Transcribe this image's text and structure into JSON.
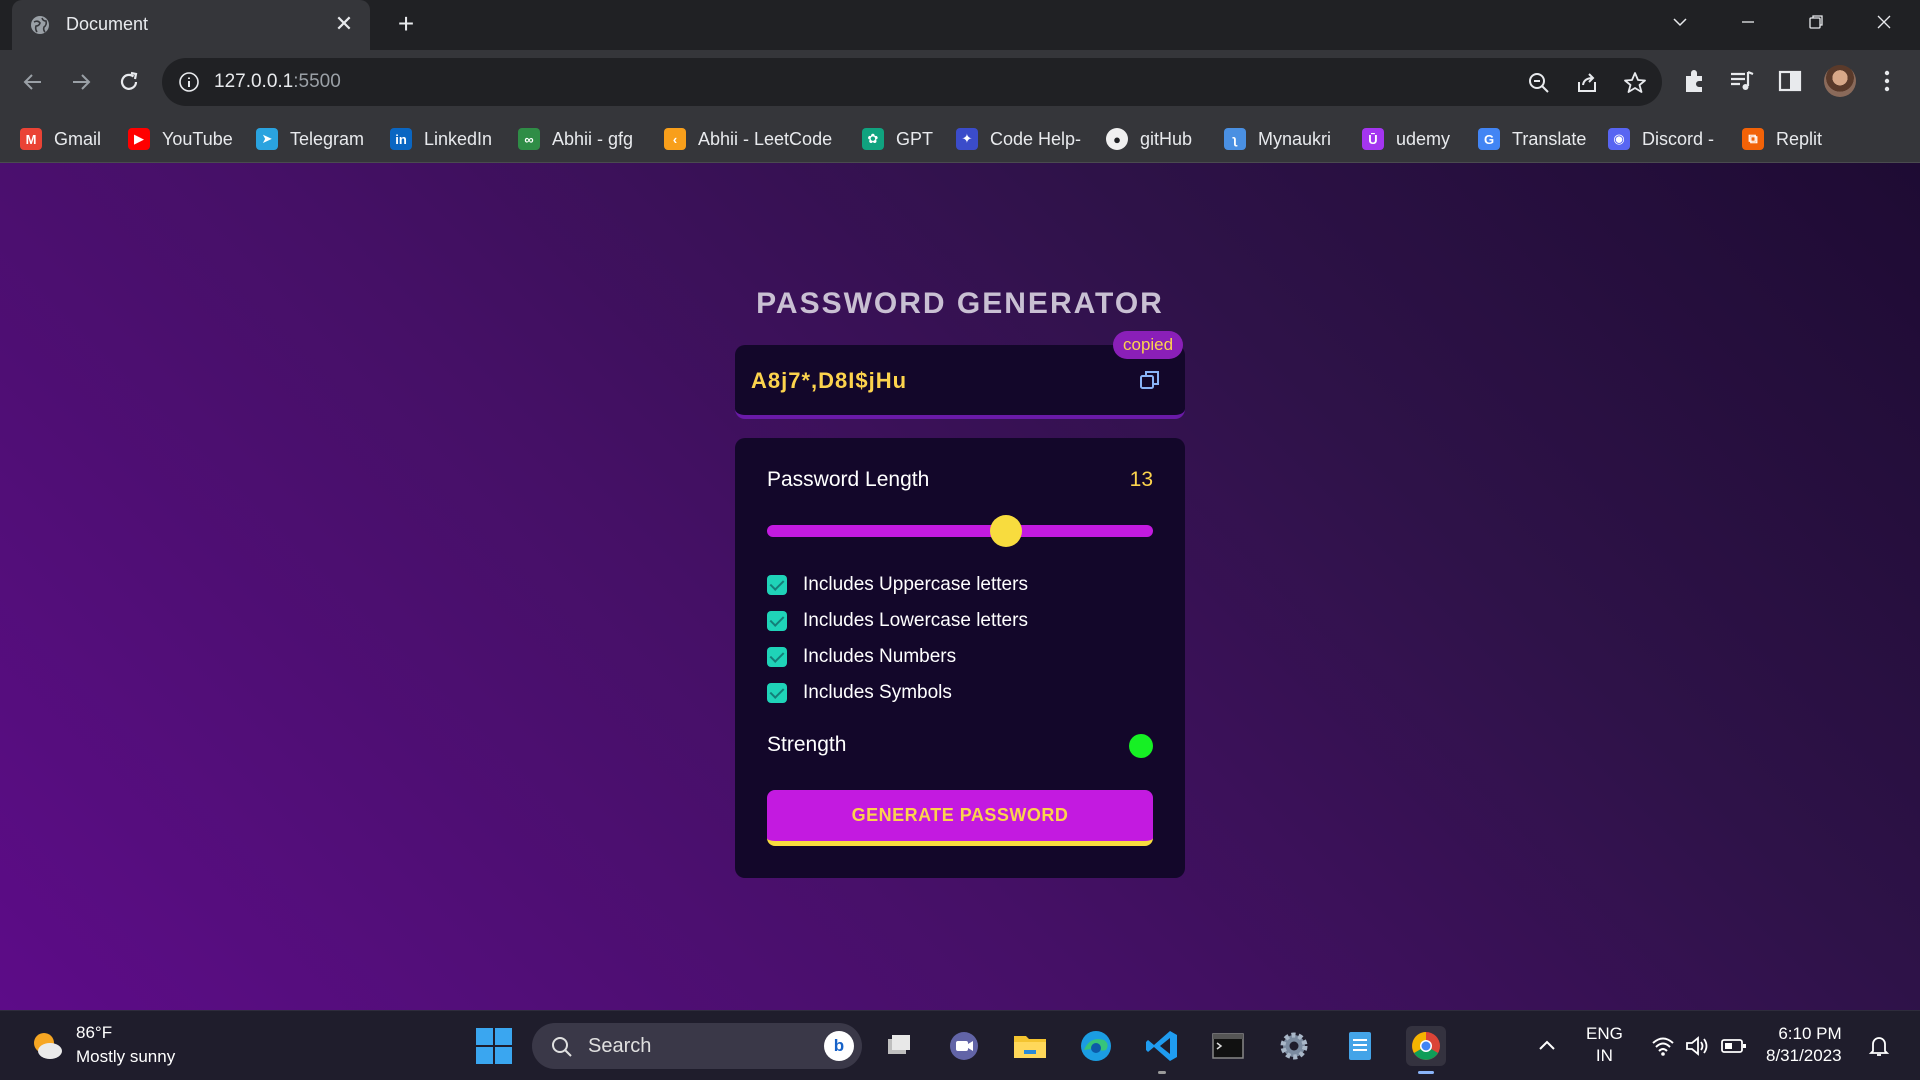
{
  "browser": {
    "tab_title": "Document",
    "url_host": "127.0.0.1",
    "url_port": ":5500",
    "bookmarks": [
      {
        "label": "Gmail",
        "icon": "gmail-icon",
        "color": "#ea4335",
        "glyph": "M"
      },
      {
        "label": "YouTube",
        "icon": "youtube-icon",
        "color": "#ff0000",
        "glyph": "▶"
      },
      {
        "label": "Telegram",
        "icon": "telegram-icon",
        "color": "#2aa3df",
        "glyph": "➤"
      },
      {
        "label": "LinkedIn",
        "icon": "linkedin-icon",
        "color": "#0a66c2",
        "glyph": "in"
      },
      {
        "label": "Abhii - gfg",
        "icon": "gfg-icon",
        "color": "#2f8d46",
        "glyph": "∞"
      },
      {
        "label": "Abhii - LeetCode",
        "icon": "leetcode-icon",
        "color": "#f89f1b",
        "glyph": "‹"
      },
      {
        "label": "GPT",
        "icon": "chatgpt-icon",
        "color": "#10a37f",
        "glyph": "✿"
      },
      {
        "label": "Code Help-",
        "icon": "codehelp-icon",
        "color": "#3b4cca",
        "glyph": "✦"
      },
      {
        "label": "gitHub",
        "icon": "github-icon",
        "color": "#f0f0f0",
        "glyph": "●"
      },
      {
        "label": "Mynaukri",
        "icon": "naukri-icon",
        "color": "#4a90e2",
        "glyph": "ʅ"
      },
      {
        "label": "udemy",
        "icon": "udemy-icon",
        "color": "#a435f0",
        "glyph": "Ū"
      },
      {
        "label": "Translate",
        "icon": "translate-icon",
        "color": "#4285f4",
        "glyph": "G"
      },
      {
        "label": "Discord -",
        "icon": "discord-icon",
        "color": "#5865f2",
        "glyph": "◉"
      },
      {
        "label": "Replit",
        "icon": "replit-icon",
        "color": "#f26207",
        "glyph": "⧉"
      }
    ]
  },
  "app": {
    "title": "PASSWORD GENERATOR",
    "password": "A8j7*,D8I$jHu",
    "copied_badge": "copied",
    "length_label": "Password Length",
    "length_value": "13",
    "slider_fraction": 0.62,
    "options": [
      {
        "label": "Includes Uppercase letters",
        "checked": true
      },
      {
        "label": "Includes Lowercase letters",
        "checked": true
      },
      {
        "label": "Includes Numbers",
        "checked": true
      },
      {
        "label": "Includes Symbols",
        "checked": true
      }
    ],
    "strength_label": "Strength",
    "strength_color": "#16f024",
    "generate_label": "GENERATE PASSWORD"
  },
  "taskbar": {
    "temperature": "86°F",
    "weather": "Mostly sunny",
    "search_placeholder": "Search",
    "lang_line1": "ENG",
    "lang_line2": "IN",
    "time": "6:10 PM",
    "date": "8/31/2023"
  }
}
